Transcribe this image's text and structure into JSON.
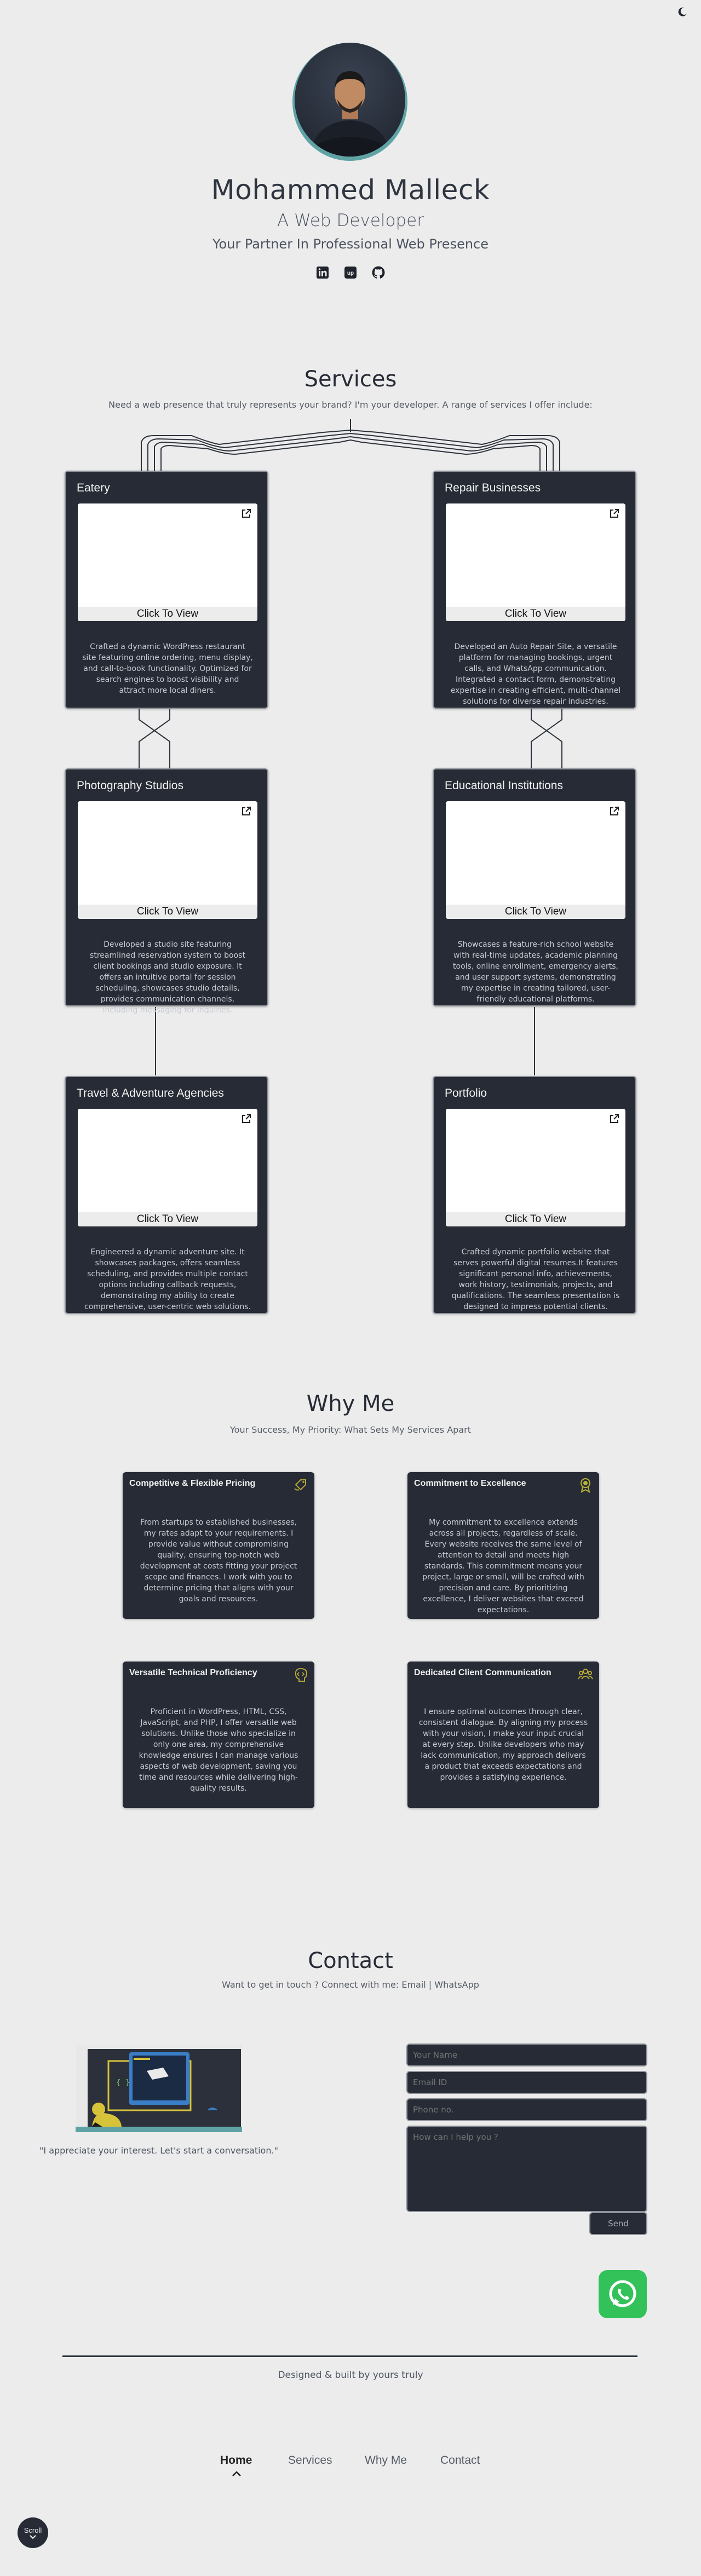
{
  "theme_toggle": {
    "icon": "moon-icon"
  },
  "hero": {
    "name": "Mohammed Malleck",
    "role": "A Web Developer",
    "tagline": "Your Partner In Professional Web Presence",
    "socials": [
      {
        "icon": "linkedin-icon"
      },
      {
        "icon": "upwork-icon"
      },
      {
        "icon": "github-icon"
      }
    ]
  },
  "services": {
    "title": "Services",
    "subtitle": "Need a web presence that truly represents your brand? I'm your developer. A range of services I offer include:",
    "cta_label": "Click To View",
    "items": [
      {
        "title": "Eatery",
        "description": "Crafted a dynamic WordPress restaurant site featuring online ordering, menu display, and call-to-book functionality. Optimized for search engines to boost visibility and attract more local diners."
      },
      {
        "title": "Repair Businesses",
        "description": "Developed an Auto Repair Site, a versatile platform for managing bookings, urgent calls, and WhatsApp communication. Integrated a contact form, demonstrating expertise in creating efficient, multi-channel solutions for diverse repair industries."
      },
      {
        "title": "Photography Studios",
        "description": "Developed a studio site featuring streamlined reservation system to boost client bookings and studio exposure. It offers an intuitive portal for session scheduling, showcases studio details, provides communication channels, including messaging for inquiries."
      },
      {
        "title": "Educational Institutions",
        "description": "Showcases a feature-rich school website with real-time updates, academic planning tools, online enrollment, emergency alerts, and user support systems, demonstrating my expertise in creating tailored, user-friendly educational platforms."
      },
      {
        "title": "Travel & Adventure Agencies",
        "description": "Engineered a dynamic adventure site. It showcases packages, offers seamless scheduling, and provides multiple contact options including callback requests, demonstrating my ability to create comprehensive, user-centric web solutions."
      },
      {
        "title": "Portfolio",
        "description": "Crafted dynamic portfolio website that serves powerful digital resumes.It features significant personal info, achievements, work history, testimonials, projects, and qualifications. The seamless presentation is designed to impress potential clients."
      }
    ]
  },
  "why": {
    "title": "Why Me",
    "subtitle": "Your Success, My Priority: What Sets My Services Apart",
    "items": [
      {
        "title": "Competitive & Flexible Pricing",
        "icon": "price-tag-icon",
        "icon_color": "#b6a637",
        "description": "From startups to established businesses, my rates adapt to your requirements. I provide value without compromising quality, ensuring top-notch web development at costs fitting your project scope and finances. I work with you to determine pricing that aligns with your goals and resources."
      },
      {
        "title": "Commitment to Excellence",
        "icon": "award-medal-icon",
        "icon_color": "#b6b337",
        "description": "My commitment to excellence extends across all projects, regardless of scale. Every website receives the same level of attention to detail and meets high standards. This commitment means your project, large or small, will be crafted with precision and care. By prioritizing excellence, I deliver websites that exceed expectations."
      },
      {
        "title": "Versatile Technical Proficiency",
        "icon": "code-brain-icon",
        "icon_color": "#b6a637",
        "description": "Proficient in WordPress, HTML, CSS, JavaScript, and PHP, I offer versatile web solutions. Unlike those who specialize in only one area, my comprehensive knowledge ensures I can manage various aspects of web development, saving you time and resources while delivering high-quality results."
      },
      {
        "title": "Dedicated Client Communication",
        "icon": "group-users-icon",
        "icon_color": "#b6a637",
        "description": "I ensure optimal outcomes through clear, consistent dialogue. By aligning my process with your vision, I make your input crucial at every step. Unlike developers who may lack communication, my approach delivers a product that exceeds expectations and provides a satisfying experience."
      }
    ]
  },
  "contact": {
    "title": "Contact",
    "subtitle": "Want to get in touch ? Connect with me: Email | WhatsApp",
    "quote": "\"I appreciate your interest. Let's start a conversation.\"",
    "placeholders": {
      "name": "Your Name",
      "email": "Email ID",
      "phone": "Phone no.",
      "message": "How can I help you ?"
    },
    "send_label": "Send",
    "whatsapp_icon": "whatsapp-icon"
  },
  "footer": {
    "credit": "Designed & built by yours truly"
  },
  "nav": {
    "items": [
      "Home",
      "Services",
      "Why Me",
      "Contact"
    ],
    "active": "Home",
    "scroll_label": "Scroll"
  }
}
